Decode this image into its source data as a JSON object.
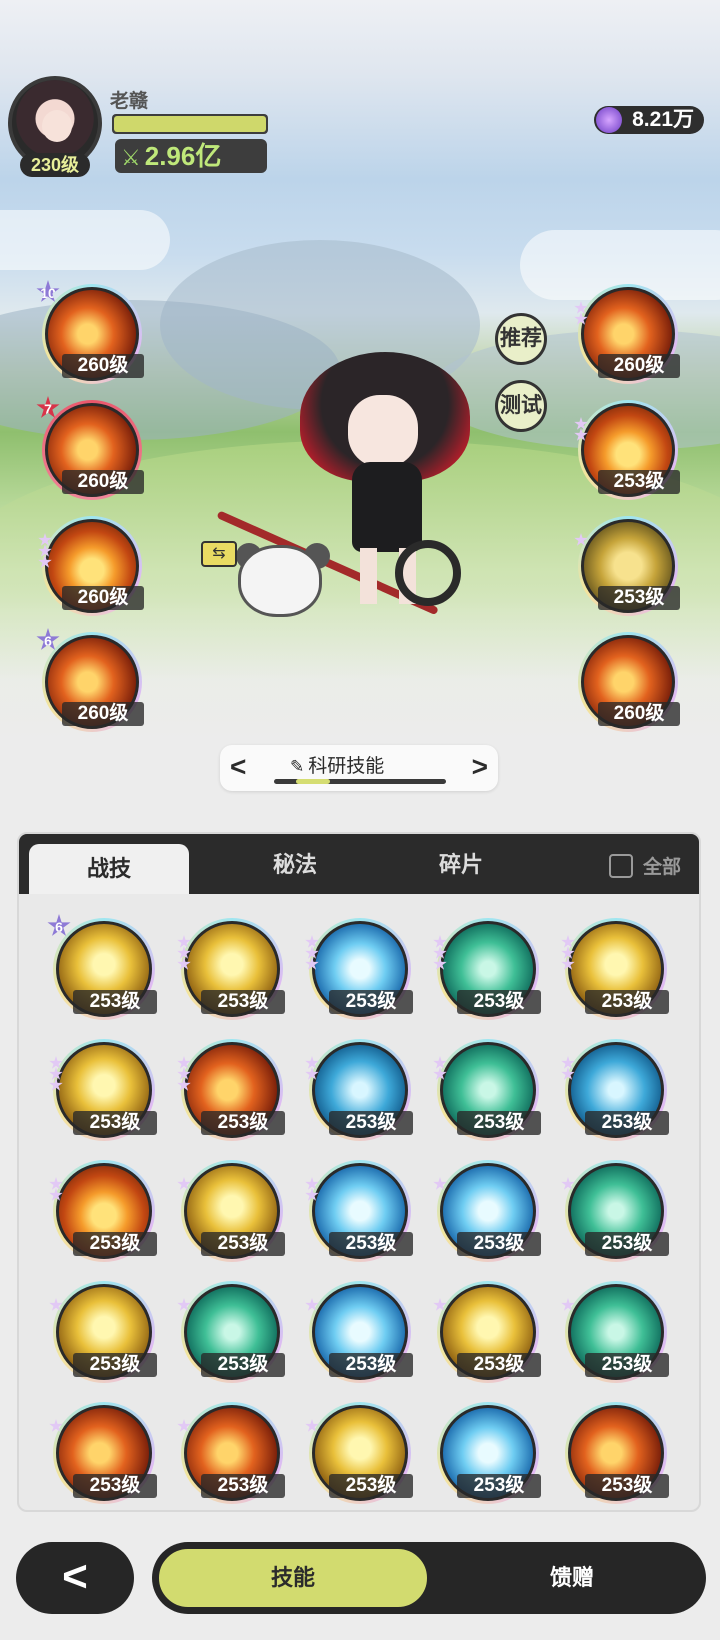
{
  "player": {
    "name": "老赣",
    "level": "230级",
    "hp_ratio": 1.0,
    "power": "2.96亿",
    "currency": "8.21万"
  },
  "battle": {
    "buttons": {
      "recommend": "推荐",
      "test": "测试"
    },
    "left_skills": [
      {
        "level": "260级",
        "stars": "10",
        "theme": "fire2",
        "frame": "normal"
      },
      {
        "level": "260级",
        "stars": "7",
        "theme": "fire2",
        "frame": "red"
      },
      {
        "level": "260级",
        "stars": "",
        "pips": 3,
        "theme": "fire",
        "frame": "normal"
      },
      {
        "level": "260级",
        "stars": "6",
        "theme": "fire2",
        "frame": "normal"
      }
    ],
    "right_skills": [
      {
        "level": "260级",
        "pips": 2,
        "theme": "fire2"
      },
      {
        "level": "253级",
        "pips": 2,
        "theme": "fire"
      },
      {
        "level": "253级",
        "pips": 1,
        "theme": "gold-shield"
      },
      {
        "level": "260级",
        "pips": 0,
        "theme": "fire2"
      }
    ],
    "swap_icon": "swap-icon"
  },
  "research": {
    "label": "科研技能",
    "icon": "pen-icon",
    "prev": "<",
    "next": ">"
  },
  "panel": {
    "tabs": [
      "战技",
      "秘法",
      "碎片"
    ],
    "active_tab": 0,
    "all_label": "全部",
    "skills": [
      {
        "level": "253级",
        "stars": "6",
        "theme": "gold"
      },
      {
        "level": "253级",
        "pips": 3,
        "theme": "gold"
      },
      {
        "level": "253级",
        "pips": 3,
        "theme": "ice"
      },
      {
        "level": "253级",
        "pips": 3,
        "theme": "jade"
      },
      {
        "level": "253级",
        "pips": 3,
        "theme": "gold"
      },
      {
        "level": "253级",
        "pips": 3,
        "theme": "gold"
      },
      {
        "level": "253级",
        "pips": 3,
        "theme": "fire2"
      },
      {
        "level": "253级",
        "pips": 2,
        "theme": "cyan"
      },
      {
        "level": "253级",
        "pips": 2,
        "theme": "jade"
      },
      {
        "level": "253级",
        "pips": 2,
        "theme": "cyan"
      },
      {
        "level": "253级",
        "pips": 2,
        "theme": "fire"
      },
      {
        "level": "253级",
        "pips": 1,
        "theme": "gold"
      },
      {
        "level": "253级",
        "pips": 2,
        "theme": "ice"
      },
      {
        "level": "253级",
        "pips": 1,
        "theme": "ice"
      },
      {
        "level": "253级",
        "pips": 1,
        "theme": "jade"
      },
      {
        "level": "253级",
        "pips": 1,
        "theme": "gold"
      },
      {
        "level": "253级",
        "pips": 1,
        "theme": "jade"
      },
      {
        "level": "253级",
        "pips": 1,
        "theme": "ice"
      },
      {
        "level": "253级",
        "pips": 1,
        "theme": "gold"
      },
      {
        "level": "253级",
        "pips": 1,
        "theme": "jade"
      },
      {
        "level": "253级",
        "pips": 1,
        "theme": "fire2"
      },
      {
        "level": "253级",
        "pips": 1,
        "theme": "fire2"
      },
      {
        "level": "253级",
        "pips": 1,
        "theme": "gold"
      },
      {
        "level": "253级",
        "pips": 0,
        "theme": "ice"
      },
      {
        "level": "253级",
        "pips": 0,
        "theme": "fire2"
      }
    ]
  },
  "bottom": {
    "back_icon": "back-arrow-icon",
    "back_glyph": "<",
    "skill_tab": "技能",
    "gift_tab": "馈赠"
  }
}
